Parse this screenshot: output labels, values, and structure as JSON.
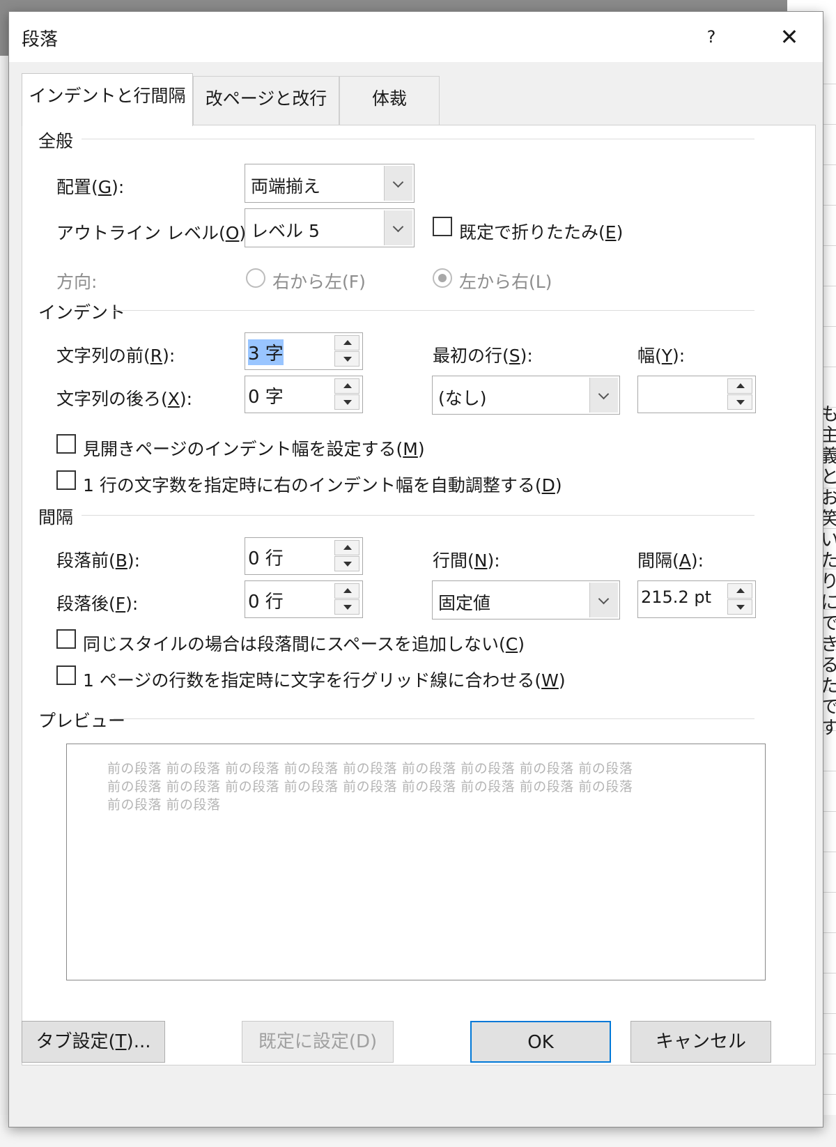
{
  "background": {
    "doc_letters": [
      "も",
      "主",
      "義",
      "と",
      "お",
      "笑",
      "い",
      "た",
      "り",
      "に",
      "で",
      "き",
      "る",
      "た",
      "で",
      "す。"
    ]
  },
  "dialog": {
    "title": "段落",
    "help_label": "?",
    "close_label": "✕"
  },
  "tabs": [
    {
      "label": "インデントと行間隔",
      "active": true
    },
    {
      "label": "改ページと改行",
      "active": false
    },
    {
      "label": "体裁",
      "active": false
    }
  ],
  "general": {
    "heading": "全般",
    "alignment": {
      "label": "配置(",
      "key": "G",
      "suffix": "):",
      "value": "両端揃え"
    },
    "outline": {
      "label": "アウトライン レベル(",
      "key": "O",
      "suffix": "):",
      "value": "レベル 5"
    },
    "collapse": {
      "label": "既定で折りたたみ(",
      "key": "E",
      "suffix": ")",
      "checked": false
    },
    "direction": {
      "label": "方向:",
      "rtl": "右から左(F)",
      "ltr": "左から右(L)",
      "selected": "ltr"
    }
  },
  "indent": {
    "heading": "インデント",
    "before": {
      "label": "文字列の前(",
      "key": "R",
      "suffix": "):",
      "value": "3 字"
    },
    "after": {
      "label": "文字列の後ろ(",
      "key": "X",
      "suffix": "):",
      "value": "0 字"
    },
    "first_line": {
      "label": "最初の行(",
      "key": "S",
      "suffix": "):",
      "value": "(なし)"
    },
    "width": {
      "label": "幅(",
      "key": "Y",
      "suffix": "):",
      "value": ""
    },
    "mirror": {
      "label": "見開きページのインデント幅を設定する(",
      "key": "M",
      "suffix": ")",
      "checked": false
    },
    "auto_adjust": {
      "label": "1 行の文字数を指定時に右のインデント幅を自動調整する(",
      "key": "D",
      "suffix": ")",
      "checked": false
    }
  },
  "spacing": {
    "heading": "間隔",
    "before": {
      "label": "段落前(",
      "key": "B",
      "suffix": "):",
      "value": "0 行"
    },
    "after": {
      "label": "段落後(",
      "key": "F",
      "suffix": "):",
      "value": "0 行"
    },
    "line_spacing": {
      "label": "行間(",
      "key": "N",
      "suffix": "):",
      "value": "固定値"
    },
    "at": {
      "label": "間隔(",
      "key": "A",
      "suffix": "):",
      "value": "215.2 pt"
    },
    "no_space_same_style": {
      "label": "同じスタイルの場合は段落間にスペースを追加しない(",
      "key": "C",
      "suffix": ")",
      "checked": false
    },
    "snap_grid": {
      "label": "1 ページの行数を指定時に文字を行グリッド線に合わせる(",
      "key": "W",
      "suffix": ")",
      "checked": false
    }
  },
  "preview": {
    "heading": "プレビュー",
    "lines": [
      "前の段落 前の段落 前の段落 前の段落 前の段落 前の段落 前の段落 前の段落 前の段落",
      "前の段落 前の段落 前の段落 前の段落 前の段落 前の段落 前の段落 前の段落 前の段落",
      "前の段落 前の段落"
    ]
  },
  "buttons": {
    "tabs": {
      "label": "タブ設定(",
      "key": "T",
      "suffix": ")..."
    },
    "set_default": "既定に設定(D)",
    "ok": "OK",
    "cancel": "キャンセル"
  }
}
